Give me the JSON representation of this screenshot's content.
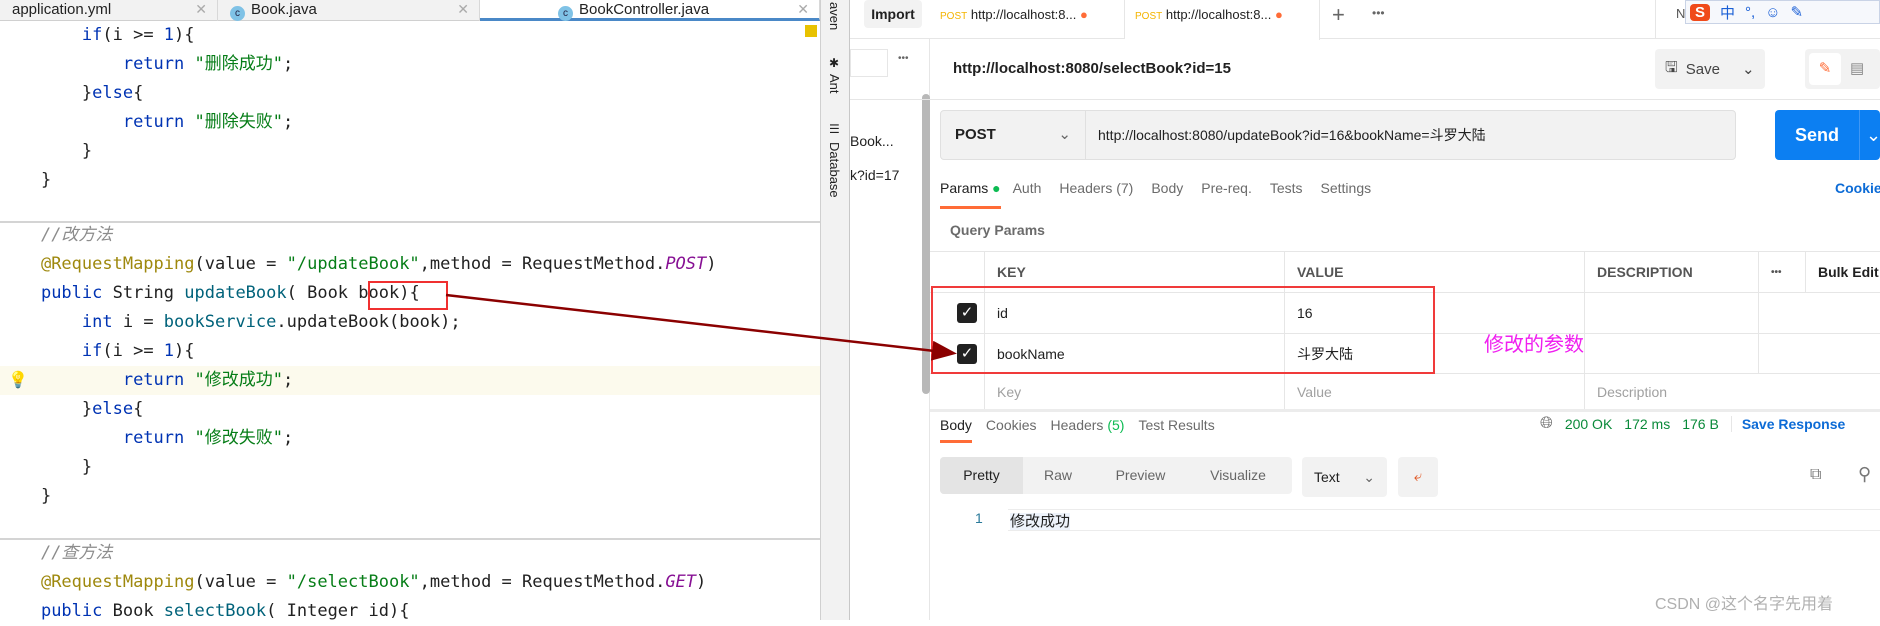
{
  "editor": {
    "tabs": [
      {
        "label": "application.yml"
      },
      {
        "label": "Book.java"
      },
      {
        "label": "BookController.java"
      }
    ],
    "delete_success": "\"删除成功\"",
    "delete_fail": "\"删除失败\"",
    "comment_update": "//改方法",
    "update_path": "\"/updateBook\"",
    "post": "POST",
    "update_success": "\"修改成功\"",
    "update_fail": "\"修改失败\"",
    "comment_select": "//查方法",
    "select_path": "\"/selectBook\"",
    "get": "GET"
  },
  "side_strip": {
    "items": [
      "aven",
      "Ant",
      "Database"
    ]
  },
  "postman": {
    "import_label": "Import",
    "tabs": [
      {
        "method": "POST",
        "label": "http://localhost:8..."
      },
      {
        "method": "POST",
        "label": "http://localhost:8..."
      }
    ],
    "env_label": "No E",
    "sidebar": {
      "item1": "Book...",
      "item2": "k?id=17"
    },
    "request_title": "http://localhost:8080/selectBook?id=15",
    "save_label": "Save",
    "method": "POST",
    "url": "http://localhost:8080/updateBook?id=16&bookName=斗罗大陆",
    "send_label": "Send",
    "req_tabs": [
      "Params",
      "Auth",
      "Headers",
      "Body",
      "Pre-req.",
      "Tests",
      "Settings"
    ],
    "headers_count": "(7)",
    "cookies_label": "Cookies",
    "query_params_label": "Query Params",
    "table": {
      "headers": [
        "KEY",
        "VALUE",
        "DESCRIPTION",
        "Bulk Edit"
      ],
      "rows": [
        {
          "key": "id",
          "value": "16",
          "checked": true
        },
        {
          "key": "bookName",
          "value": "斗罗大陆",
          "checked": true
        }
      ],
      "placeholders": {
        "key": "Key",
        "value": "Value",
        "description": "Description"
      }
    },
    "annotation": "修改的参数",
    "resp_tabs": [
      "Body",
      "Cookies",
      "Headers",
      "Test Results"
    ],
    "resp_headers_count": "(5)",
    "status": "200 OK",
    "time": "172 ms",
    "size": "176 B",
    "save_response": "Save Response",
    "view_modes": [
      "Pretty",
      "Raw",
      "Preview",
      "Visualize"
    ],
    "format": "Text",
    "response_line_no": "1",
    "response_body": "修改成功",
    "accent": "#ff6c37",
    "send_color": "#0c7ff2"
  },
  "watermark": "CSDN @这个名字先用着"
}
